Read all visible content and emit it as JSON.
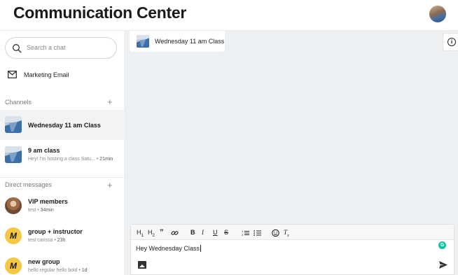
{
  "header": {
    "title": "Communication Center"
  },
  "sidebar": {
    "search_placeholder": "Search a chat",
    "marketing_label": "Marketing Email",
    "channels_label": "Channels",
    "channels": [
      {
        "title": "Wednesday 11 am Class",
        "subtitle": "",
        "time": ""
      },
      {
        "title": "9 am class",
        "subtitle": "Hey! I'm hosting a class Satu...",
        "time": "21min"
      }
    ],
    "direct_label": "Direct messages",
    "direct": [
      {
        "title": "VIP members",
        "subtitle": "test",
        "time": "34min",
        "avatar": "photo"
      },
      {
        "title": "group + instructor",
        "subtitle": "test carissa",
        "time": "23h",
        "avatar_letter": "M"
      },
      {
        "title": "new group",
        "subtitle": "hello regular hello bold",
        "time": "1d",
        "avatar_letter": "M"
      }
    ]
  },
  "main": {
    "active_chat": "Wednesday 11 am Class",
    "info_icon": "i",
    "composer": {
      "draft": "Hey Wednesday Class",
      "toolbar": [
        "H1",
        "H2",
        "quote",
        "link",
        "B",
        "I",
        "U",
        "S",
        "ordered-list",
        "bullet-list",
        "emoji",
        "clear-format"
      ],
      "grammarly_letter": "G"
    }
  },
  "colors": {
    "main_bg": "#edf0f2",
    "active_row": "#f2f3f4",
    "avatar_yellow": "#f6c744",
    "grammarly_green": "#15c39a"
  }
}
